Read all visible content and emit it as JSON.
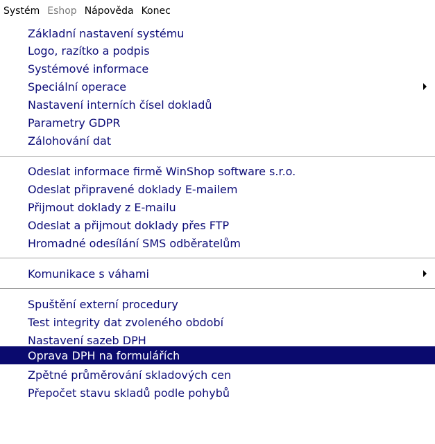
{
  "menubar": {
    "items": [
      {
        "label": "Systém",
        "disabled": false
      },
      {
        "label": "Eshop",
        "disabled": true
      },
      {
        "label": "Nápověda",
        "disabled": false
      },
      {
        "label": "Konec",
        "disabled": false
      }
    ]
  },
  "menu": {
    "group1": [
      {
        "label": "Základní nastavení systému"
      },
      {
        "label": "Logo, razítko a podpis"
      },
      {
        "label": "Systémové informace"
      },
      {
        "label": "Speciální operace"
      },
      {
        "label": "Nastavení interních čísel dokladů"
      },
      {
        "label": "Parametry GDPR"
      },
      {
        "label": "Zálohování dat"
      }
    ],
    "group2": [
      {
        "label": "Odeslat informace firmě WinShop software s.r.o."
      },
      {
        "label": "Odeslat připravené doklady E-mailem"
      },
      {
        "label": "Přijmout doklady z E-mailu"
      },
      {
        "label": "Odeslat a přijmout doklady přes FTP"
      },
      {
        "label": "Hromadné odesílání SMS odběratelům"
      }
    ],
    "group3": [
      {
        "label": "Komunikace s váhami"
      }
    ],
    "group4": [
      {
        "label": "Spuštění externí procedury"
      },
      {
        "label": "Test integrity dat zvoleného období"
      },
      {
        "label": "Nastavení sazeb DPH"
      },
      {
        "label": "Oprava DPH na formulářích"
      },
      {
        "label": "Zpětné průměrování skladových cen"
      },
      {
        "label": "Přepočet stavu skladů podle pohybů"
      }
    ]
  },
  "colors": {
    "item_text": "#0c0c78",
    "selection_bg": "#0a0a6e",
    "selection_text": "#ffffff",
    "disabled_text": "#7a7a7a"
  }
}
